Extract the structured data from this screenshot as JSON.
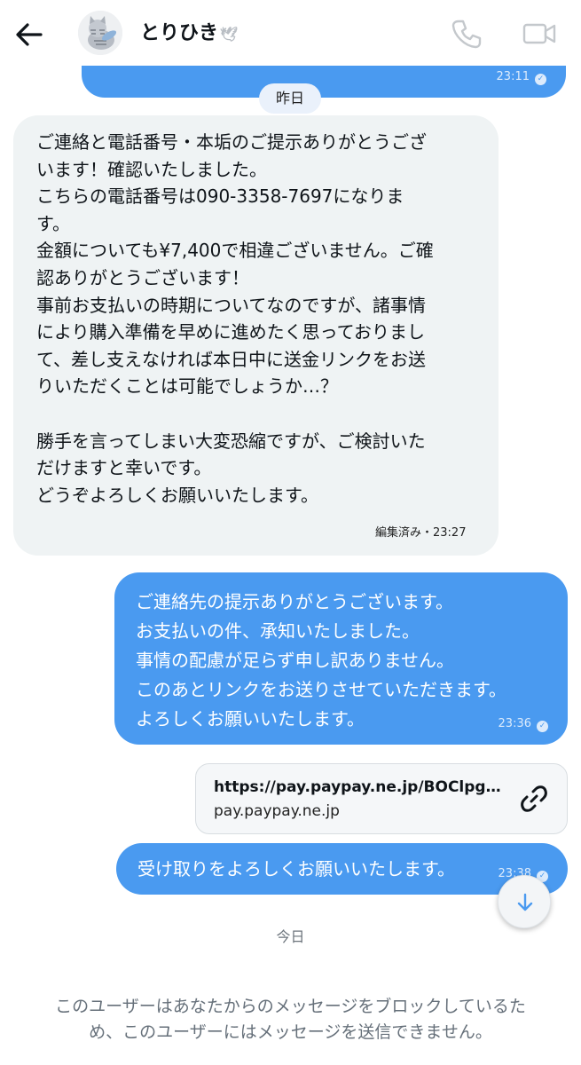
{
  "header": {
    "contact_name": "とりひき",
    "name_emoji": "🕊"
  },
  "messages": {
    "previous": {
      "time": "23:11"
    },
    "yesterday_label": "昨日",
    "incoming": {
      "lines": [
        "ご連絡と電話番号・本垢のご提示ありがとうござ",
        "います！確認いたしました。",
        "こちらの電話番号は090-3358-7697になりま",
        "す。",
        "金額についても¥7,400で相違ございません。ご確",
        "認ありがとうございます！",
        "事前お支払いの時期についてなのですが、諸事情",
        "により購入準備を早めに進めたく思っておりまし",
        "て、差し支えなければ本日中に送金リンクをお送",
        "りいただくことは可能でしょうか…？",
        "",
        "勝手を言ってしまい大変恐縮ですが、ご検討いた",
        "だけますと幸いです。",
        "どうぞよろしくお願いいたします。"
      ],
      "meta": "編集済み・23:27"
    },
    "outgoing_reply": {
      "lines": [
        "ご連絡先の提示ありがとうございます。",
        "お支払いの件、承知いたしました。",
        "事情の配慮が足らず申し訳ありません。",
        "このあとリンクをお送りさせていただきます。",
        "よろしくお願いいたします。"
      ],
      "time": "23:36"
    },
    "link_card": {
      "url": "https://pay.paypay.ne.jp/BOClpgv...",
      "domain": "pay.paypay.ne.jp"
    },
    "outgoing_last": {
      "text": "受け取りをよろしくお願いいたします。",
      "time": "23:38"
    },
    "today_label": "今日"
  },
  "blocked_notice": {
    "lines": [
      "このユーザーはあなたからのメッセージをブロックしているた",
      "め、このユーザーにはメッセージを送信できません。"
    ]
  },
  "icons": {
    "back": "arrow-left-icon",
    "call": "phone-icon",
    "video": "video-camera-icon",
    "link": "link-icon",
    "scroll_down": "arrow-down-icon",
    "read": "check-circle-icon"
  },
  "colors": {
    "outgoing_bubble": "#4a9af0",
    "incoming_bubble": "#eff3f4",
    "date_pill": "#eaf1fb"
  }
}
